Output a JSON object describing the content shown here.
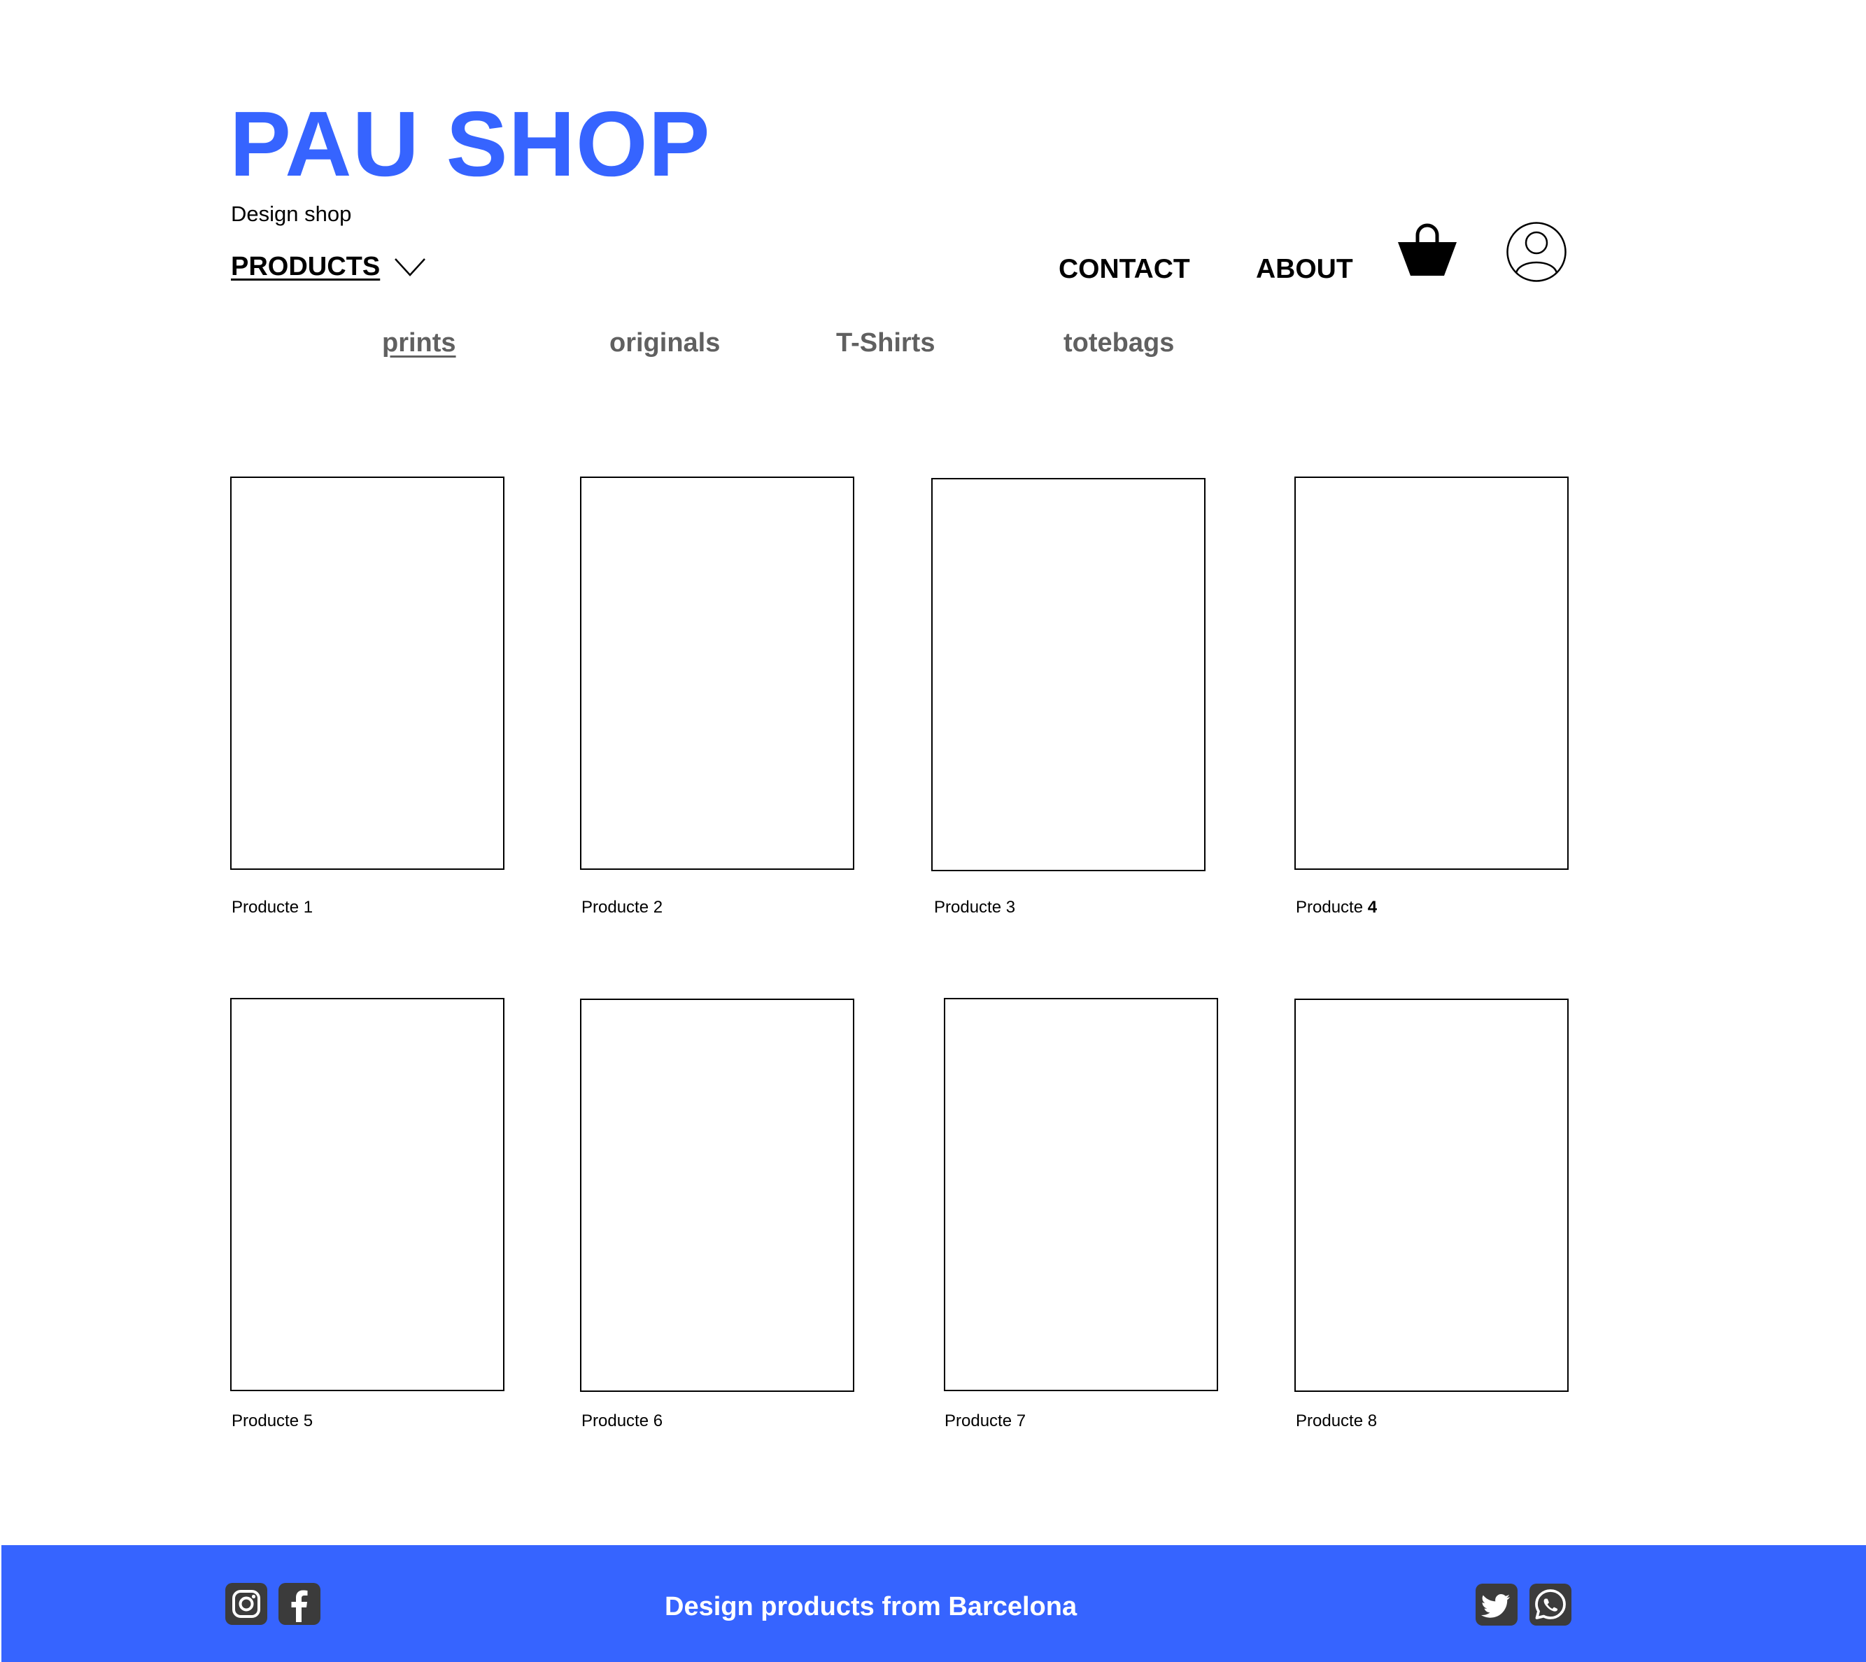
{
  "header": {
    "brand": "PAU SHOP",
    "tagline": "Design shop",
    "brand_color": "#3664ff"
  },
  "nav": {
    "products_label": "PRODUCTS",
    "products_icon": "chevron-down-icon",
    "contact_label": "CONTACT",
    "about_label": "ABOUT",
    "cart_icon": "shopping-bag-icon",
    "account_icon": "user-icon"
  },
  "subnav": {
    "items": [
      {
        "label": "prints",
        "active": true
      },
      {
        "label": "originals",
        "active": false
      },
      {
        "label": "T-Shirts",
        "active": false
      },
      {
        "label": "totebags",
        "active": false
      }
    ],
    "color": "#606060"
  },
  "products": [
    {
      "label_prefix": "Producte",
      "label_number": "1"
    },
    {
      "label_prefix": "Producte",
      "label_number": "2"
    },
    {
      "label_prefix": "Producte",
      "label_number": "3"
    },
    {
      "label_prefix": "Producte",
      "label_number": "4"
    },
    {
      "label_prefix": "Producte",
      "label_number": "5"
    },
    {
      "label_prefix": "Producte",
      "label_number": "6"
    },
    {
      "label_prefix": "Producte",
      "label_number": "7"
    },
    {
      "label_prefix": "Producte",
      "label_number": "8"
    }
  ],
  "footer": {
    "text": "Design products from Barcelona",
    "background": "#3664ff",
    "social_left": [
      "instagram-icon",
      "facebook-icon"
    ],
    "social_right": [
      "twitter-icon",
      "whatsapp-icon"
    ]
  }
}
